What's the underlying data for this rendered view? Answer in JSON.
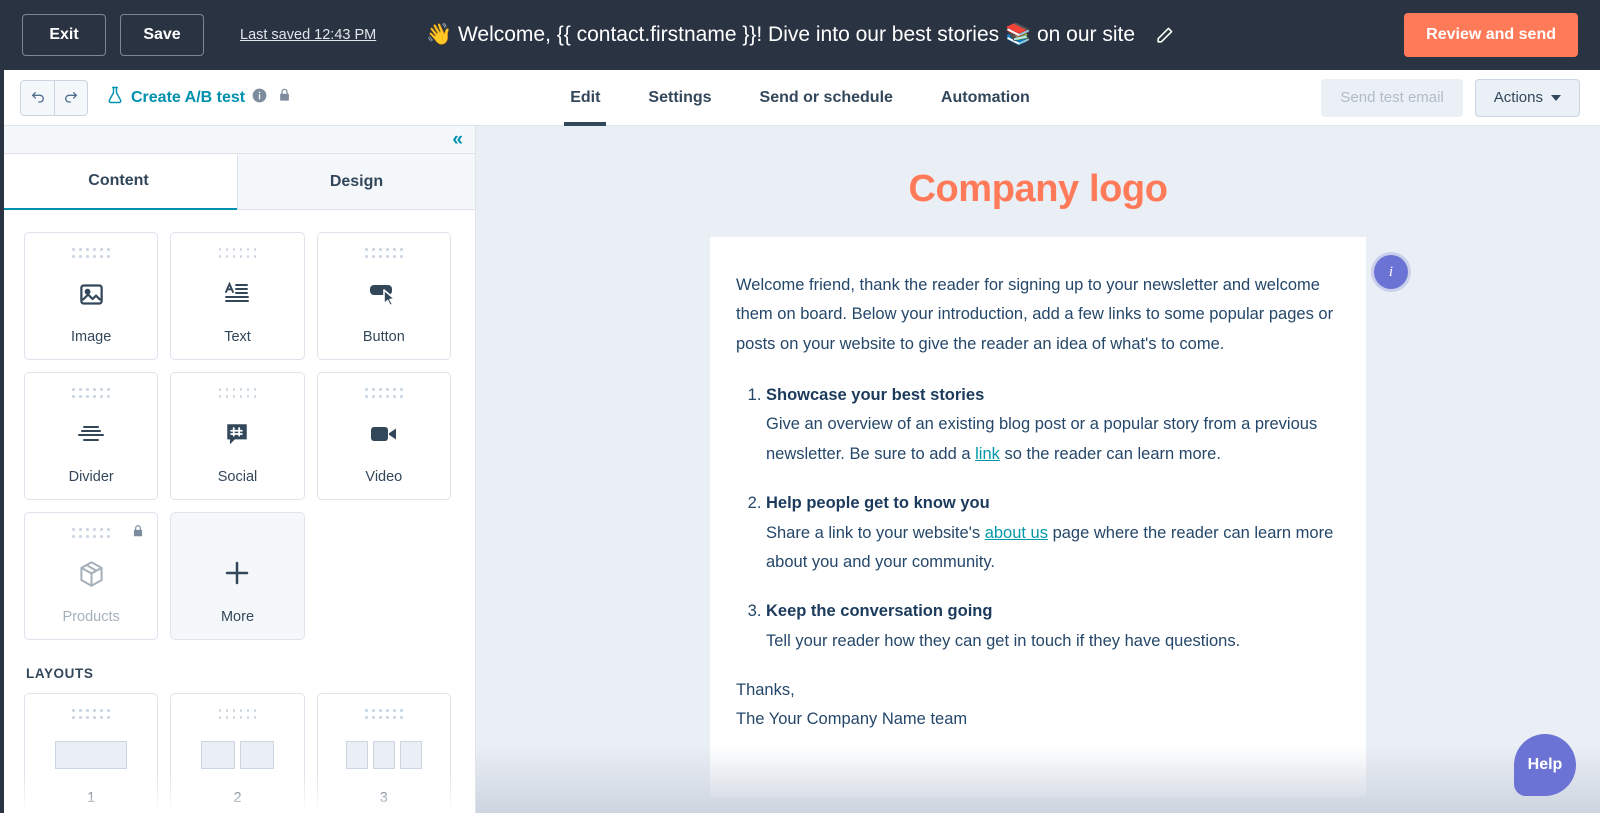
{
  "topbar": {
    "exit_label": "Exit",
    "save_label": "Save",
    "last_saved": "Last saved 12:43 PM",
    "subject_title": "👋 Welcome, {{ contact.firstname }}! Dive into our best stories 📚 on our site",
    "edit_icon": "pencil-icon",
    "review_label": "Review and send",
    "accent_color": "#ff7a59",
    "bar_color": "#2a3342"
  },
  "navbar": {
    "undo_icon": "undo-icon",
    "redo_icon": "redo-icon",
    "ab_test_label": "Create A/B test",
    "ab_test_icon": "flask-icon",
    "info_icon": "info-circle-icon",
    "lock_icon": "lock-icon",
    "tabs": [
      {
        "label": "Edit",
        "active": true
      },
      {
        "label": "Settings",
        "active": false
      },
      {
        "label": "Send or schedule",
        "active": false
      },
      {
        "label": "Automation",
        "active": false
      }
    ],
    "send_test_label": "Send test email",
    "send_test_disabled": true,
    "actions_label": "Actions",
    "link_color": "#0091ae"
  },
  "sidebar": {
    "collapse_icon": "chevron-double-left-icon",
    "tabs": [
      {
        "label": "Content",
        "active": true
      },
      {
        "label": "Design",
        "active": false
      }
    ],
    "modules": [
      {
        "label": "Image",
        "icon": "image-icon",
        "locked": false,
        "variant": "normal"
      },
      {
        "label": "Text",
        "icon": "text-icon",
        "locked": false,
        "variant": "normal"
      },
      {
        "label": "Button",
        "icon": "button-cursor-icon",
        "locked": false,
        "variant": "normal"
      },
      {
        "label": "Divider",
        "icon": "divider-icon",
        "locked": false,
        "variant": "normal"
      },
      {
        "label": "Social",
        "icon": "social-hash-bubble-icon",
        "locked": false,
        "variant": "normal"
      },
      {
        "label": "Video",
        "icon": "video-camera-icon",
        "locked": false,
        "variant": "normal"
      },
      {
        "label": "Products",
        "icon": "box-package-icon",
        "locked": true,
        "variant": "normal"
      },
      {
        "label": "More",
        "icon": "plus-icon",
        "locked": false,
        "variant": "more"
      }
    ],
    "layouts_title": "LAYOUTS",
    "layouts": [
      {
        "label": "1",
        "columns": 1
      },
      {
        "label": "2",
        "columns": 2
      },
      {
        "label": "3",
        "columns": 3
      }
    ]
  },
  "email": {
    "logo_text": "Company logo",
    "logo_color": "#ff7a59",
    "info_badge_label": "i",
    "intro": "Welcome friend, thank the reader for signing up to your newsletter and welcome them on board. Below your introduction, add a few links to some popular pages or posts on your website to give the reader an idea of what's to come.",
    "list": [
      {
        "heading": "Showcase your best stories",
        "body_before": "Give an overview of an existing blog post or a popular story from a previous newsletter. Be sure to add a ",
        "link": "link",
        "body_after": " so the reader can learn more."
      },
      {
        "heading": "Help people get to know you",
        "body_before": "Share a link to your website's ",
        "link": "about us",
        "body_after": " page where the reader can learn more about you and your community."
      },
      {
        "heading": "Keep the conversation going",
        "body_before": "Tell your reader how they can get in touch if they have questions.",
        "link": "",
        "body_after": ""
      }
    ],
    "signoff_1": "Thanks,",
    "signoff_2": "The Your Company Name team",
    "link_color": "#0099a8",
    "text_color": "#25476a"
  },
  "help": {
    "label": "Help",
    "color": "#6b73d4"
  }
}
